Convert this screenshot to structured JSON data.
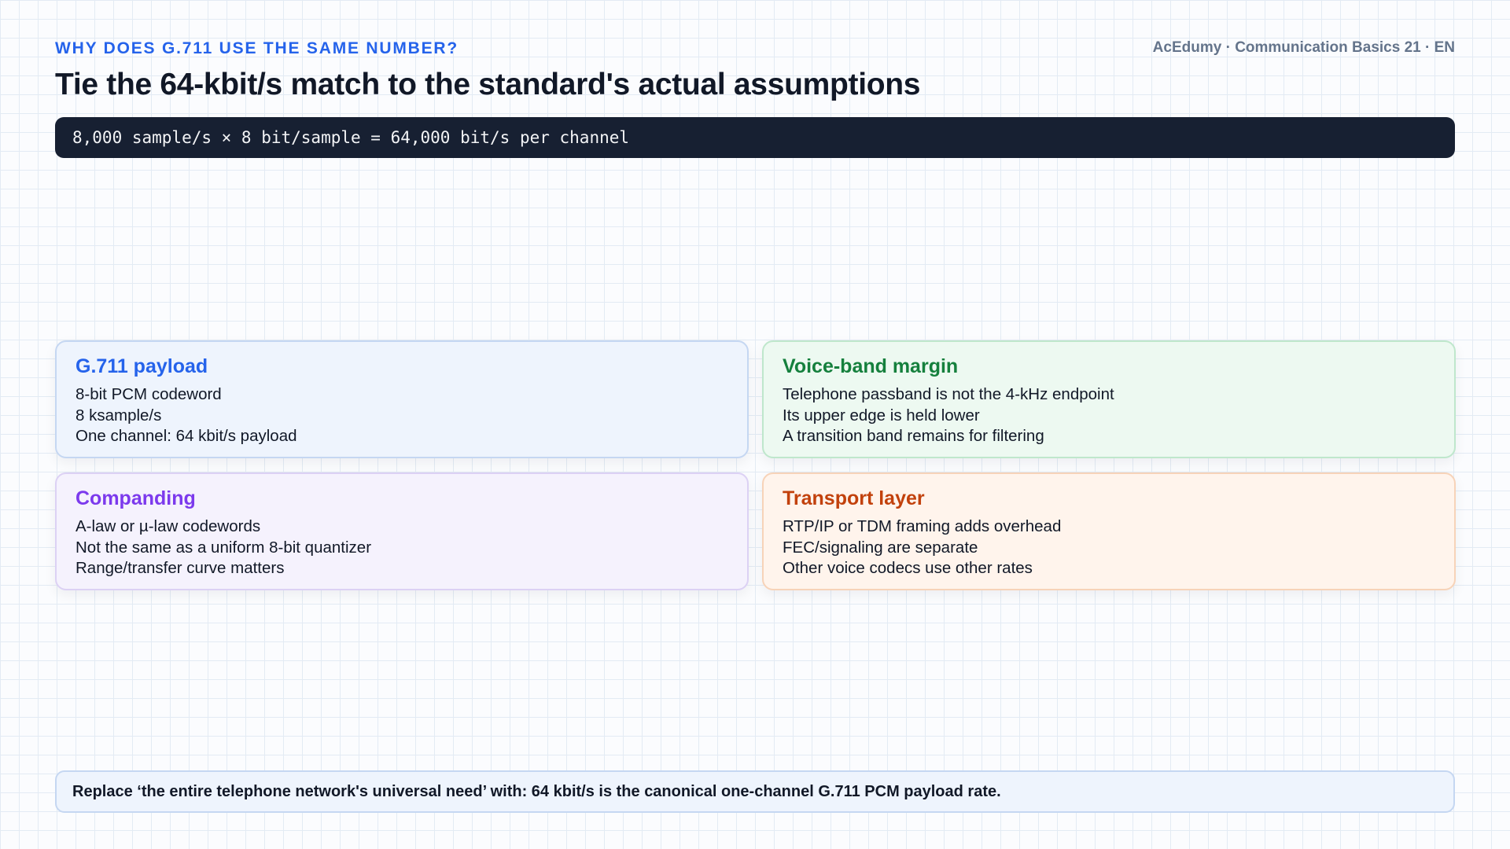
{
  "header": {
    "kicker": "WHY DOES G.711 USE THE SAME NUMBER?",
    "brand": "AcEdumy · Communication Basics 21 · EN",
    "title": "Tie the 64-kbit/s match to the standard's actual assumptions",
    "formula": "8,000 sample/s × 8 bit/sample = 64,000 bit/s per channel"
  },
  "cards": [
    {
      "title": "G.711 payload",
      "lines": [
        "8-bit PCM codeword",
        "8 ksample/s",
        "One channel: 64 kbit/s payload"
      ],
      "accent": "#2563eb"
    },
    {
      "title": "Voice-band margin",
      "lines": [
        "Telephone passband is not the 4-kHz endpoint",
        "Its upper edge is held lower",
        "A transition band remains for filtering"
      ],
      "accent": "#15803d"
    },
    {
      "title": "Companding",
      "lines": [
        "A-law or µ-law codewords",
        "Not the same as a uniform 8-bit quantizer",
        "Range/transfer curve matters"
      ],
      "accent": "#7c3aed"
    },
    {
      "title": "Transport layer",
      "lines": [
        "RTP/IP or TDM framing adds overhead",
        "FEC/signaling are separate",
        "Other voice codecs use other rates"
      ],
      "accent": "#c2410c"
    }
  ],
  "footer": {
    "note": "Replace ‘the entire telephone network's universal need’ with: 64 kbit/s is the canonical one-channel G.711 PCM payload rate."
  }
}
